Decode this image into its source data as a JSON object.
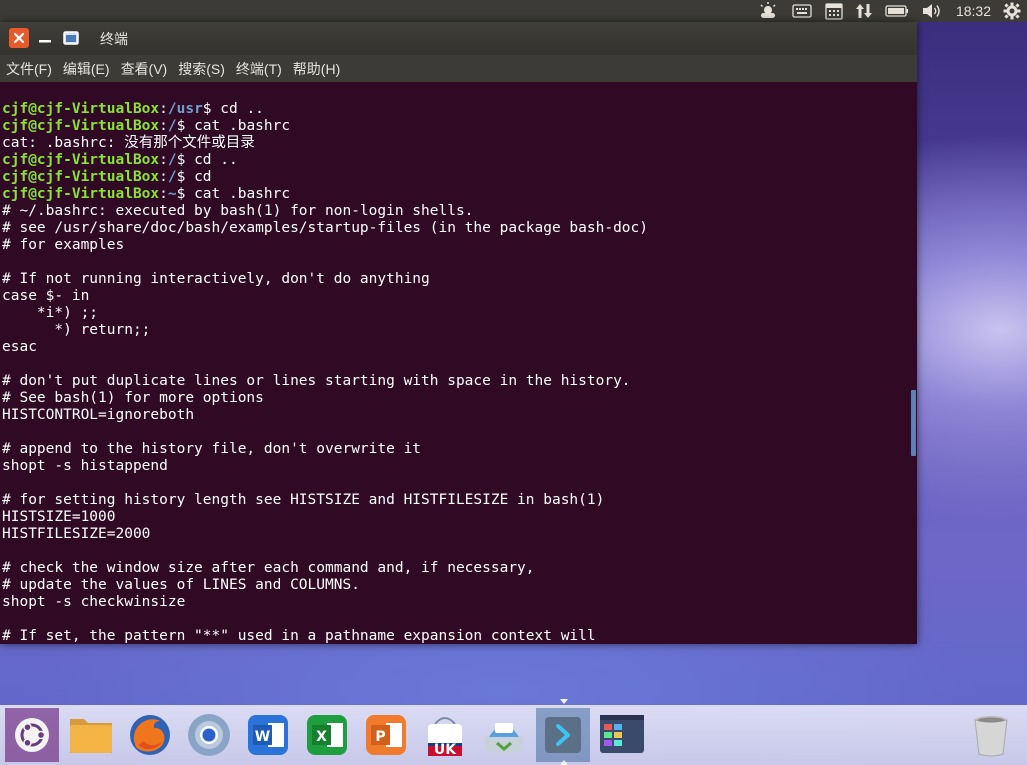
{
  "top_panel": {
    "icons": [
      "weather-icon",
      "keyboard-icon",
      "calendar-icon",
      "network-updown-icon",
      "battery-icon",
      "volume-icon"
    ],
    "clock": "18:32",
    "settings_icon": "gear-icon"
  },
  "window": {
    "title": "终端",
    "menu": [
      "文件(F)",
      "编辑(E)",
      "查看(V)",
      "搜索(S)",
      "终端(T)",
      "帮助(H)"
    ]
  },
  "terminal": {
    "user_host": "cjf@cjf-VirtualBox",
    "lines": [
      {
        "prompt": true,
        "path": "/usr",
        "cmd": " cd .."
      },
      {
        "prompt": true,
        "path": "/",
        "cmd": " cat .bashrc"
      },
      {
        "text": "cat: .bashrc: 没有那个文件或目录"
      },
      {
        "prompt": true,
        "path": "/",
        "cmd": " cd .."
      },
      {
        "prompt": true,
        "path": "/",
        "cmd": " cd"
      },
      {
        "prompt": true,
        "path": "~",
        "cmd": " cat .bashrc"
      },
      {
        "text": "# ~/.bashrc: executed by bash(1) for non-login shells."
      },
      {
        "text": "# see /usr/share/doc/bash/examples/startup-files (in the package bash-doc)"
      },
      {
        "text": "# for examples"
      },
      {
        "text": ""
      },
      {
        "text": "# If not running interactively, don't do anything"
      },
      {
        "text": "case $- in"
      },
      {
        "text": "    *i*) ;;"
      },
      {
        "text": "      *) return;;"
      },
      {
        "text": "esac"
      },
      {
        "text": ""
      },
      {
        "text": "# don't put duplicate lines or lines starting with space in the history."
      },
      {
        "text": "# See bash(1) for more options"
      },
      {
        "text": "HISTCONTROL=ignoreboth"
      },
      {
        "text": ""
      },
      {
        "text": "# append to the history file, don't overwrite it"
      },
      {
        "text": "shopt -s histappend"
      },
      {
        "text": ""
      },
      {
        "text": "# for setting history length see HISTSIZE and HISTFILESIZE in bash(1)"
      },
      {
        "text": "HISTSIZE=1000"
      },
      {
        "text": "HISTFILESIZE=2000"
      },
      {
        "text": ""
      },
      {
        "text": "# check the window size after each command and, if necessary,"
      },
      {
        "text": "# update the values of LINES and COLUMNS."
      },
      {
        "text": "shopt -s checkwinsize"
      },
      {
        "text": ""
      },
      {
        "text": "# If set, the pattern \"**\" used in a pathname expansion context will"
      }
    ]
  },
  "dock": {
    "items": [
      "ubuntu-launcher-icon",
      "files-icon",
      "firefox-icon",
      "chromium-icon",
      "wps-writer-icon",
      "wps-spreadsheet-icon",
      "wps-presentation-icon",
      "ubuntu-software-icon",
      "software-updater-icon",
      "terminal-icon",
      "workspace-switcher-icon"
    ],
    "trash": "trash-icon",
    "software_center_label": "UK"
  }
}
